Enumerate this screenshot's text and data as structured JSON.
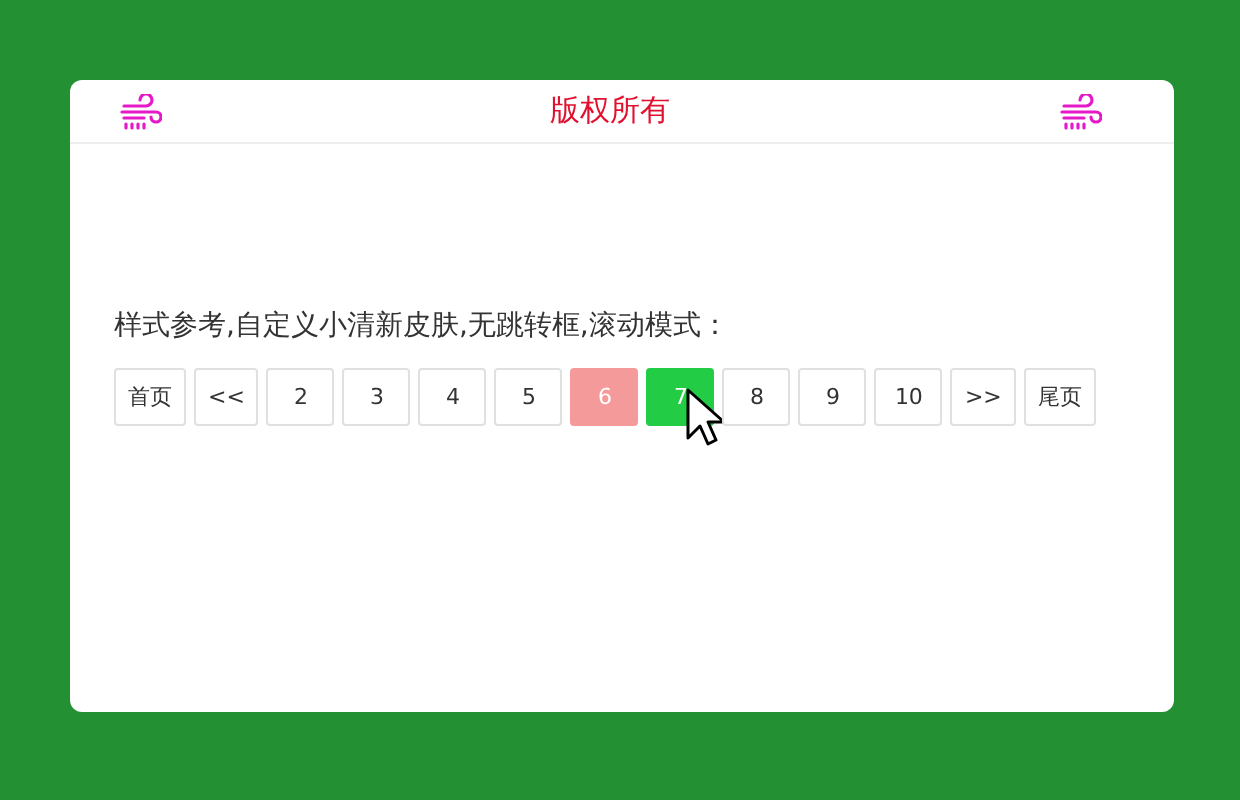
{
  "header": {
    "title": "版权所有"
  },
  "description": "样式参考,自定义小清新皮肤,无跳转框,滚动模式：",
  "pagination": [
    {
      "label": "首页",
      "kind": "nav",
      "selected": false,
      "hovered": false
    },
    {
      "label": "<<",
      "kind": "nav",
      "selected": false,
      "hovered": false
    },
    {
      "label": "2",
      "kind": "page",
      "selected": false,
      "hovered": false
    },
    {
      "label": "3",
      "kind": "page",
      "selected": false,
      "hovered": false
    },
    {
      "label": "4",
      "kind": "page",
      "selected": false,
      "hovered": false
    },
    {
      "label": "5",
      "kind": "page",
      "selected": false,
      "hovered": false
    },
    {
      "label": "6",
      "kind": "page",
      "selected": true,
      "hovered": false
    },
    {
      "label": "7",
      "kind": "page",
      "selected": false,
      "hovered": true
    },
    {
      "label": "8",
      "kind": "page",
      "selected": false,
      "hovered": false
    },
    {
      "label": "9",
      "kind": "page",
      "selected": false,
      "hovered": false
    },
    {
      "label": "10",
      "kind": "page",
      "selected": false,
      "hovered": false
    },
    {
      "label": ">>",
      "kind": "nav",
      "selected": false,
      "hovered": false
    },
    {
      "label": "尾页",
      "kind": "nav",
      "selected": false,
      "hovered": false
    }
  ]
}
